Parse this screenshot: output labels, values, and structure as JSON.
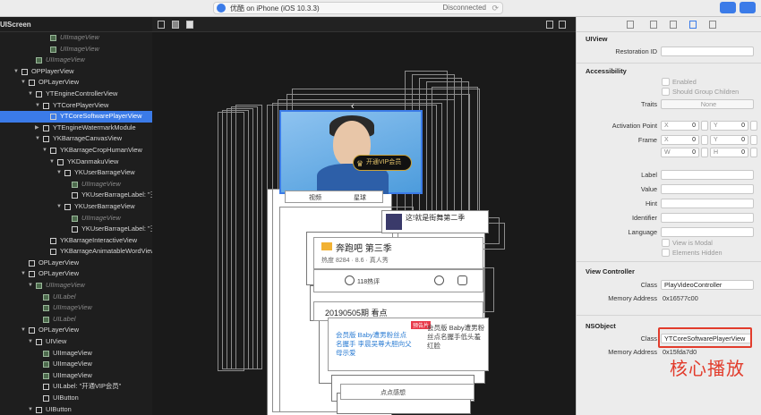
{
  "toolbar": {
    "scheme_text": "优酷 on iPhone (iOS 10.3.3)",
    "status": "Disconnected"
  },
  "tree": {
    "header": "UIScreen",
    "rows": [
      {
        "label": "UIImageView",
        "indent": 56,
        "icon": "img",
        "dim": true
      },
      {
        "label": "UIImageView",
        "indent": 56,
        "icon": "img",
        "dim": true
      },
      {
        "label": "UIImageView",
        "indent": 40,
        "icon": "img",
        "dim": true
      },
      {
        "label": "OPPlayerView",
        "indent": 24,
        "tri": "open",
        "icon": "box"
      },
      {
        "label": "OPLayerView",
        "indent": 32,
        "tri": "open",
        "icon": "box"
      },
      {
        "label": "YTEngineControllerView",
        "indent": 40,
        "tri": "open",
        "icon": "box"
      },
      {
        "label": "YTCorePlayerView",
        "indent": 48,
        "tri": "open",
        "icon": "box"
      },
      {
        "label": "YTCoreSoftwarePlayerView",
        "indent": 56,
        "icon": "box",
        "selected": true
      },
      {
        "label": "YTEngineWatermarkModule",
        "indent": 48,
        "tri": "closed",
        "icon": "box"
      },
      {
        "label": "YKBarrageCanvasView",
        "indent": 48,
        "tri": "open",
        "icon": "box"
      },
      {
        "label": "YKBarrageCropHumanView",
        "indent": 56,
        "tri": "open",
        "icon": "box"
      },
      {
        "label": "YKDanmakuView",
        "indent": 64,
        "tri": "open",
        "icon": "box"
      },
      {
        "label": "YKUserBarrageView",
        "indent": 72,
        "tri": "open",
        "icon": "box"
      },
      {
        "label": "UIImageView",
        "indent": 80,
        "icon": "img",
        "dim": true
      },
      {
        "label": "YKUserBarrageLabel: \"王",
        "indent": 80,
        "icon": "box"
      },
      {
        "label": "YKUserBarrageView",
        "indent": 72,
        "tri": "open",
        "icon": "box"
      },
      {
        "label": "UIImageView",
        "indent": 80,
        "icon": "img",
        "dim": true
      },
      {
        "label": "YKUserBarrageLabel: \"王",
        "indent": 80,
        "icon": "box"
      },
      {
        "label": "YKBarrageInteractiveView",
        "indent": 56,
        "icon": "box"
      },
      {
        "label": "YKBarrageAnimatableWordView",
        "indent": 56,
        "icon": "box"
      },
      {
        "label": "OPLayerView",
        "indent": 32,
        "icon": "box"
      },
      {
        "label": "OPLayerView",
        "indent": 32,
        "tri": "open",
        "icon": "box"
      },
      {
        "label": "UIImageView",
        "indent": 40,
        "tri": "open",
        "icon": "img",
        "dim": true
      },
      {
        "label": "UILabel",
        "indent": 48,
        "icon": "img",
        "dim": true
      },
      {
        "label": "UIImageView",
        "indent": 48,
        "icon": "img",
        "dim": true
      },
      {
        "label": "UILabel",
        "indent": 48,
        "icon": "img",
        "dim": true
      },
      {
        "label": "OPLayerView",
        "indent": 32,
        "tri": "open",
        "icon": "box"
      },
      {
        "label": "UIView",
        "indent": 40,
        "tri": "open",
        "icon": "box"
      },
      {
        "label": "UIImageView",
        "indent": 48,
        "icon": "img"
      },
      {
        "label": "UIImageView",
        "indent": 48,
        "icon": "img"
      },
      {
        "label": "UIImageView",
        "indent": 48,
        "icon": "img"
      },
      {
        "label": "UILabel: \"开通VIP会员\"",
        "indent": 48,
        "icon": "box"
      },
      {
        "label": "UIButton",
        "indent": 48,
        "icon": "box"
      },
      {
        "label": "UIButton",
        "indent": 40,
        "tri": "open",
        "icon": "box"
      }
    ]
  },
  "canvas": {
    "vip_button": "开通VIP会员",
    "tab_video": "视频",
    "tab_star": "星球",
    "bullet_text": "这!就是街舞第二季",
    "show_title": "奔跑吧 第三季",
    "show_meta": "热度 8284 · 8.6 · 真人秀",
    "comment_count": "118热评",
    "episode": "20190505期 看点",
    "rec_badge": "预告片",
    "rec_text_1": "会员版 Baby遭男粉丝点名握手 李晨吴尊大胆向父母示爱",
    "rec_text_2": "会员版 Baby遭男粉丝点名握手低头羞红脸",
    "bottom_text": "点点感想"
  },
  "inspector": {
    "uiview": {
      "title": "UIView",
      "restoration_label": "Restoration ID"
    },
    "accessibility": {
      "title": "Accessibility",
      "enabled": "Enabled",
      "group_children": "Should Group Children",
      "traits_label": "Traits",
      "traits_value": "None",
      "activation_label": "Activation Point",
      "frame_label": "Frame",
      "ap_x": "0",
      "ap_y": "0",
      "fr_x": "0",
      "fr_y": "0",
      "fr_w": "0",
      "fr_h": "0",
      "key_x": "X",
      "key_y": "Y",
      "key_w": "W",
      "key_h": "H",
      "label": "Label",
      "value": "Value",
      "hint": "Hint",
      "identifier": "Identifier",
      "language": "Language",
      "modal": "View is Modal",
      "hidden": "Elements Hidden"
    },
    "view_controller": {
      "title": "View Controller",
      "class_label": "Class",
      "class_value": "PlayVideoController",
      "address_label": "Memory Address",
      "address_value": "0x16577c00"
    },
    "nsobject": {
      "title": "NSObject",
      "class_label": "Class",
      "class_value": "YTCoreSoftwarePlayerView",
      "address_label": "Memory Address",
      "address_value": "0x15fda7d0"
    }
  },
  "annotation": {
    "text": "核心播放",
    "color": "#e23c2c"
  },
  "colors": {
    "selection": "#3b7be8"
  }
}
